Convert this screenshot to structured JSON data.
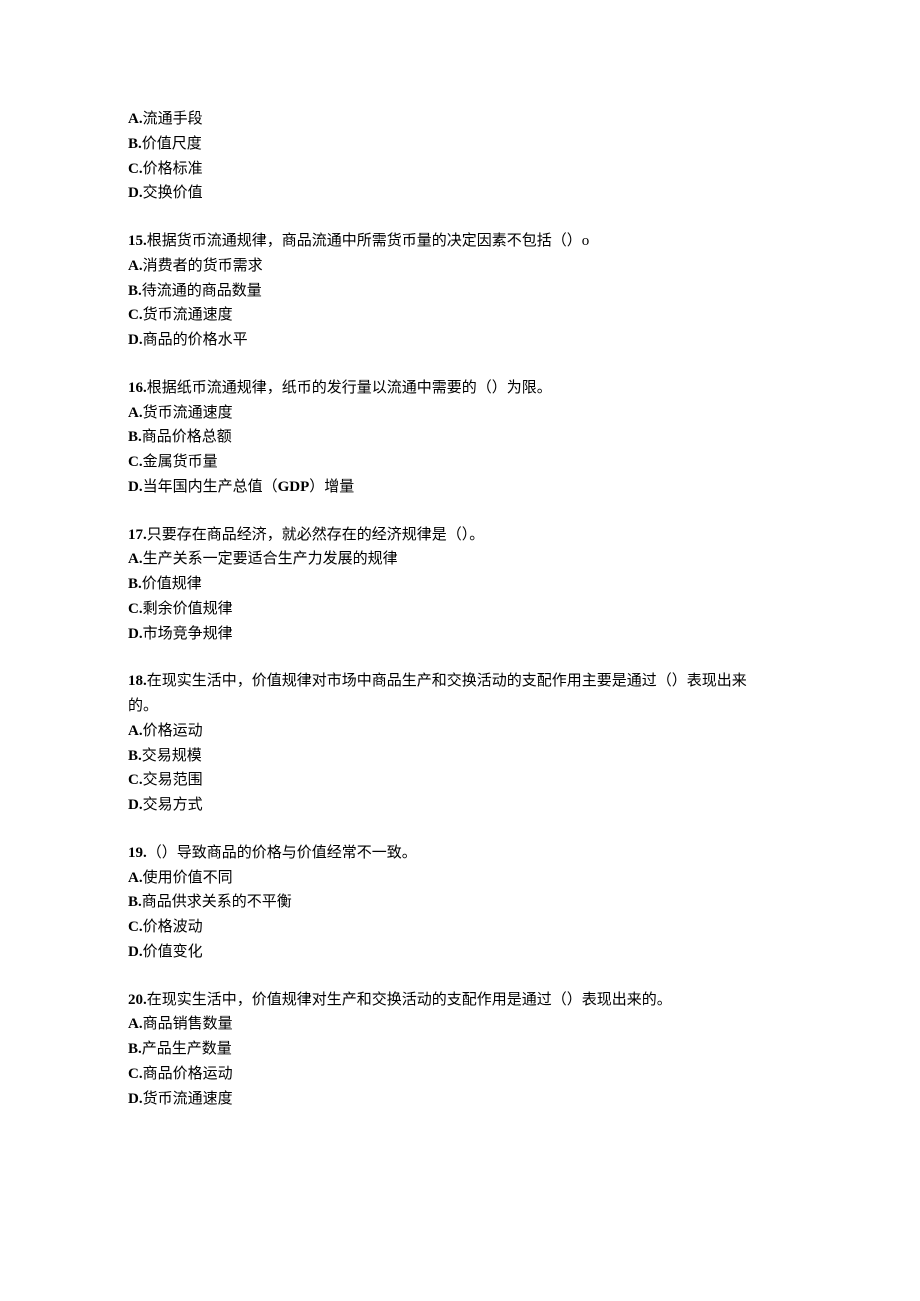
{
  "q14": {
    "optA_label": "A.",
    "optA_text": "流通手段",
    "optB_label": "B.",
    "optB_text": "价值尺度",
    "optC_label": "C.",
    "optC_text": "价格标准",
    "optD_label": "D.",
    "optD_text": "交换价值"
  },
  "q15": {
    "num": "15.",
    "stem": "根据货币流通规律，商品流通中所需货币量的决定因素不包括（）o",
    "optA_label": "A.",
    "optA_text": "消费者的货币需求",
    "optB_label": "B.",
    "optB_text": "待流通的商品数量",
    "optC_label": "C.",
    "optC_text": "货币流通速度",
    "optD_label": "D.",
    "optD_text": "商品的价格水平"
  },
  "q16": {
    "num": "16.",
    "stem": "根据纸币流通规律，纸币的发行量以流通中需要的（）为限。",
    "optA_label": "A.",
    "optA_text": "货币流通速度",
    "optB_label": "B.",
    "optB_text": "商品价格总额",
    "optC_label": "C.",
    "optC_text": "金属货币量",
    "optD_label": "D.",
    "optD_text_pre": "当年国内生产总值（",
    "optD_gdp": "GDP",
    "optD_text_post": "）增量"
  },
  "q17": {
    "num": "17.",
    "stem": "只要存在商品经济，就必然存在的经济规律是（）。",
    "optA_label": "A.",
    "optA_text": "生产关系一定要适合生产力发展的规律",
    "optB_label": "B.",
    "optB_text": "价值规律",
    "optC_label": "C.",
    "optC_text": "剩余价值规律",
    "optD_label": "D.",
    "optD_text": "市场竞争规律"
  },
  "q18": {
    "num": "18.",
    "stem_line1": "在现实生活中，价值规律对市场中商品生产和交换活动的支配作用主要是通过（）表现出来",
    "stem_line2": "的。",
    "optA_label": "A.",
    "optA_text": "价格运动",
    "optB_label": "B.",
    "optB_text": "交易规模",
    "optC_label": "C.",
    "optC_text": "交易范围",
    "optD_label": "D.",
    "optD_text": "交易方式"
  },
  "q19": {
    "num": "19.",
    "stem": "（）导致商品的价格与价值经常不一致。",
    "optA_label": "A.",
    "optA_text": "使用价值不同",
    "optB_label": "B.",
    "optB_text": "商品供求关系的不平衡",
    "optC_label": "C.",
    "optC_text": "价格波动",
    "optD_label": "D.",
    "optD_text": "价值变化"
  },
  "q20": {
    "num": "20.",
    "stem": "在现实生活中，价值规律对生产和交换活动的支配作用是通过（）表现出来的。",
    "optA_label": "A.",
    "optA_text": "商品销售数量",
    "optB_label": "B.",
    "optB_text": "产品生产数量",
    "optC_label": "C.",
    "optC_text": "商品价格运动",
    "optD_label": "D.",
    "optD_text": "货币流通速度"
  }
}
